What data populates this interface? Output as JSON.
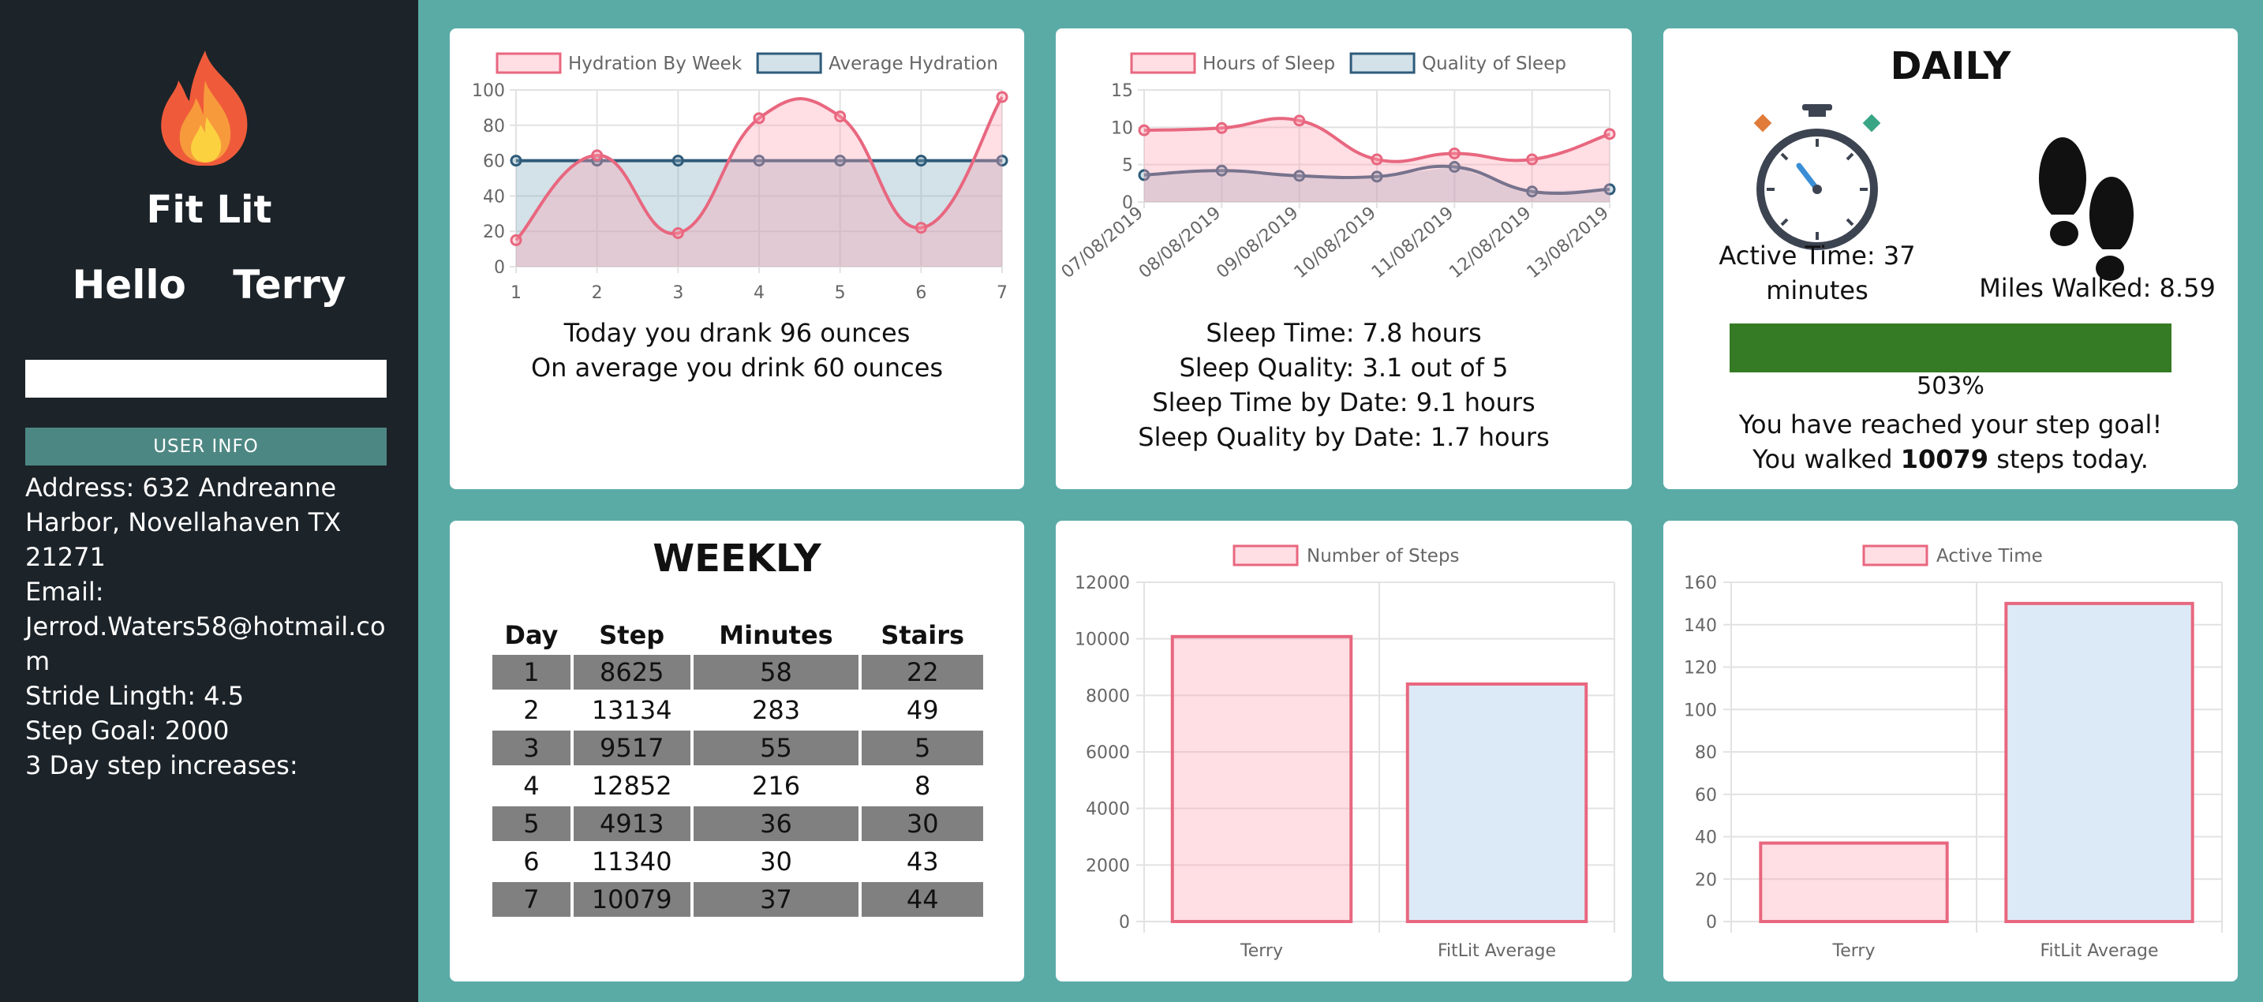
{
  "sidebar": {
    "app_title": "Fit Lit",
    "greeting_word": "Hello",
    "user_name": "Terry",
    "search_value": "",
    "user_info_button": "USER INFO",
    "details": [
      "Address: 632 Andreanne Harbor, Novellahaven TX 21271",
      "Email: Jerrod.Waters58@hotmail.com",
      "Stride Lingth: 4.5",
      "Step Goal: 2000",
      "3 Day step increases:"
    ]
  },
  "hydration": {
    "line1": "Today you drank 96 ounces",
    "line2": "On average you drink 60 ounces"
  },
  "sleep": {
    "line1": "Sleep Time: 7.8 hours",
    "line2": "Sleep Quality: 3.1 out of 5",
    "line3": "Sleep Time by Date: 9.1 hours",
    "line4": "Sleep Quality by Date: 1.7 hours"
  },
  "daily": {
    "title": "DAILY",
    "active_time": "Active Time: 37 minutes",
    "miles_walked": "Miles Walked: 8.59",
    "progress_fraction": 1.0,
    "progress_color": "#357a25",
    "percent": "503%",
    "goal_message": "You have reached your step goal!",
    "walked_prefix": "You walked",
    "walked_steps": "10079",
    "walked_suffix": "steps today."
  },
  "weekly": {
    "title": "WEEKLY",
    "headers": [
      "Day",
      "Step",
      "Minutes",
      "Stairs"
    ],
    "rows": [
      [
        "1",
        "8625",
        "58",
        "22"
      ],
      [
        "2",
        "13134",
        "283",
        "49"
      ],
      [
        "3",
        "9517",
        "55",
        "5"
      ],
      [
        "4",
        "12852",
        "216",
        "8"
      ],
      [
        "5",
        "4913",
        "36",
        "30"
      ],
      [
        "6",
        "11340",
        "30",
        "43"
      ],
      [
        "7",
        "10079",
        "37",
        "44"
      ]
    ]
  },
  "colors": {
    "pink_line": "#e8677f",
    "pink_fill": "rgba(255,160,178,0.35)",
    "blue_line": "#2e5b7a",
    "blue_fill": "rgba(130,170,190,0.35)",
    "bar_blue_fill": "#dceaf7"
  },
  "chart_data": [
    {
      "type": "line",
      "x": [
        1,
        2,
        3,
        4,
        5,
        6,
        7
      ],
      "series": [
        {
          "name": "Hydration By Week",
          "values": [
            15,
            63,
            19,
            84,
            85,
            22,
            96
          ]
        },
        {
          "name": "Average Hydration",
          "values": [
            60,
            60,
            60,
            60,
            60,
            60,
            60
          ]
        }
      ],
      "ylim": [
        0,
        100
      ],
      "yticks": [
        0,
        20,
        40,
        60,
        80,
        100
      ],
      "legend": "top",
      "grid": true
    },
    {
      "type": "line",
      "x": [
        "07/08/2019",
        "08/08/2019",
        "09/08/2019",
        "10/08/2019",
        "11/08/2019",
        "12/08/2019",
        "13/08/2019"
      ],
      "series": [
        {
          "name": "Hours of Sleep",
          "values": [
            9.6,
            9.9,
            10.9,
            5.7,
            6.5,
            5.7,
            9.1
          ]
        },
        {
          "name": "Quality of Sleep",
          "values": [
            3.6,
            4.2,
            3.5,
            3.4,
            4.7,
            1.4,
            1.7
          ]
        }
      ],
      "ylim": [
        0,
        15
      ],
      "yticks": [
        0,
        5,
        10,
        15
      ],
      "legend": "top",
      "grid": true
    },
    {
      "type": "bar",
      "categories": [
        "Terry",
        "FitLit Average"
      ],
      "series": [
        {
          "name": "Number of Steps",
          "values": [
            10079,
            8400
          ]
        }
      ],
      "ylim": [
        0,
        12000
      ],
      "yticks": [
        0,
        2000,
        4000,
        6000,
        8000,
        10000,
        12000
      ],
      "legend": "top",
      "grid": true
    },
    {
      "type": "bar",
      "categories": [
        "Terry",
        "FitLit Average"
      ],
      "series": [
        {
          "name": "Active Time",
          "values": [
            37,
            150
          ]
        }
      ],
      "ylim": [
        0,
        160
      ],
      "yticks": [
        0,
        20,
        40,
        60,
        80,
        100,
        120,
        140,
        160
      ],
      "legend": "top",
      "grid": true
    }
  ]
}
